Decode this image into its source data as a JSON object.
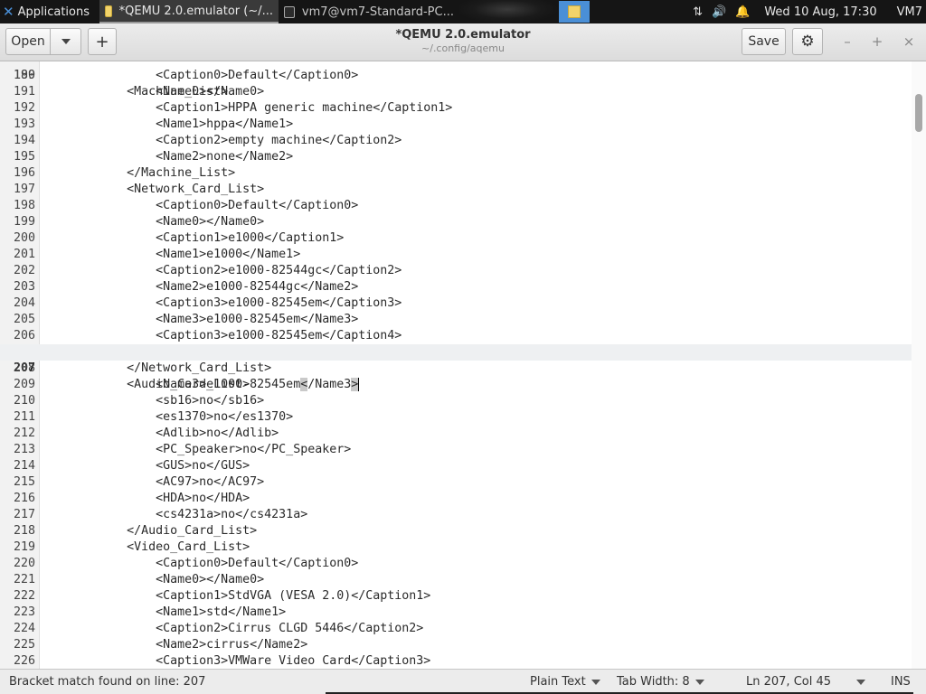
{
  "taskbar": {
    "apps_label": "Applications",
    "tasks": [
      {
        "label": "*QEMU 2.0.emulator (~/...",
        "active": true
      },
      {
        "label": "vm7@vm7-Standard-PC...",
        "active": false
      }
    ],
    "clock": "Wed 10 Aug, 17:30",
    "user": "VM7"
  },
  "header": {
    "open_label": "Open",
    "new_label": "+",
    "title": "*QEMU 2.0.emulator",
    "subtitle": "~/.config/aqemu",
    "save_label": "Save",
    "min_glyph": "–",
    "max_glyph": "+",
    "close_glyph": "×"
  },
  "editor": {
    "first_visible_line": "189",
    "first_visible_text": "            <Machine_List>",
    "lines": [
      {
        "n": "190",
        "t": "                <Caption0>Default</Caption0>"
      },
      {
        "n": "191",
        "t": "                <Name0></Name0>"
      },
      {
        "n": "192",
        "t": "                <Caption1>HPPA generic machine</Caption1>"
      },
      {
        "n": "193",
        "t": "                <Name1>hppa</Name1>"
      },
      {
        "n": "194",
        "t": "                <Caption2>empty machine</Caption2>"
      },
      {
        "n": "195",
        "t": "                <Name2>none</Name2>"
      },
      {
        "n": "196",
        "t": "            </Machine_List>"
      },
      {
        "n": "197",
        "t": "            <Network_Card_List>"
      },
      {
        "n": "198",
        "t": "                <Caption0>Default</Caption0>"
      },
      {
        "n": "199",
        "t": "                <Name0></Name0>"
      },
      {
        "n": "200",
        "t": "                <Caption1>e1000</Caption1>"
      },
      {
        "n": "201",
        "t": "                <Name1>e1000</Name1>"
      },
      {
        "n": "202",
        "t": "                <Caption2>e1000-82544gc</Caption2>"
      },
      {
        "n": "203",
        "t": "                <Name2>e1000-82544gc</Name2>"
      },
      {
        "n": "204",
        "t": "                <Caption3>e1000-82545em</Caption3>"
      },
      {
        "n": "205",
        "t": "                <Name3>e1000-82545em</Name3>"
      },
      {
        "n": "206",
        "t": "                <Caption3>e1000-82545em</Caption4>"
      }
    ],
    "current_line": {
      "n": "207",
      "pre": "                <Name3>e1000-82545em",
      "m1": "<",
      "mid": "/Name3",
      "m2": ">"
    },
    "lines_after": [
      {
        "n": "208",
        "t": "            </Network_Card_List>"
      },
      {
        "n": "209",
        "t": "            <Audio_Card_List>"
      },
      {
        "n": "210",
        "t": "                <sb16>no</sb16>"
      },
      {
        "n": "211",
        "t": "                <es1370>no</es1370>"
      },
      {
        "n": "212",
        "t": "                <Adlib>no</Adlib>"
      },
      {
        "n": "213",
        "t": "                <PC_Speaker>no</PC_Speaker>"
      },
      {
        "n": "214",
        "t": "                <GUS>no</GUS>"
      },
      {
        "n": "215",
        "t": "                <AC97>no</AC97>"
      },
      {
        "n": "216",
        "t": "                <HDA>no</HDA>"
      },
      {
        "n": "217",
        "t": "                <cs4231a>no</cs4231a>"
      },
      {
        "n": "218",
        "t": "            </Audio_Card_List>"
      },
      {
        "n": "219",
        "t": "            <Video_Card_List>"
      },
      {
        "n": "220",
        "t": "                <Caption0>Default</Caption0>"
      },
      {
        "n": "221",
        "t": "                <Name0></Name0>"
      },
      {
        "n": "222",
        "t": "                <Caption1>StdVGA (VESA 2.0)</Caption1>"
      },
      {
        "n": "223",
        "t": "                <Name1>std</Name1>"
      },
      {
        "n": "224",
        "t": "                <Caption2>Cirrus CLGD 5446</Caption2>"
      },
      {
        "n": "225",
        "t": "                <Name2>cirrus</Name2>"
      },
      {
        "n": "226",
        "t": "                <Caption3>VMWare Video Card</Caption3>"
      }
    ]
  },
  "status": {
    "message": "Bracket match found on line: 207",
    "language": "Plain Text",
    "tab_width": "Tab Width: 8",
    "position": "Ln 207, Col 45",
    "mode": "INS"
  }
}
